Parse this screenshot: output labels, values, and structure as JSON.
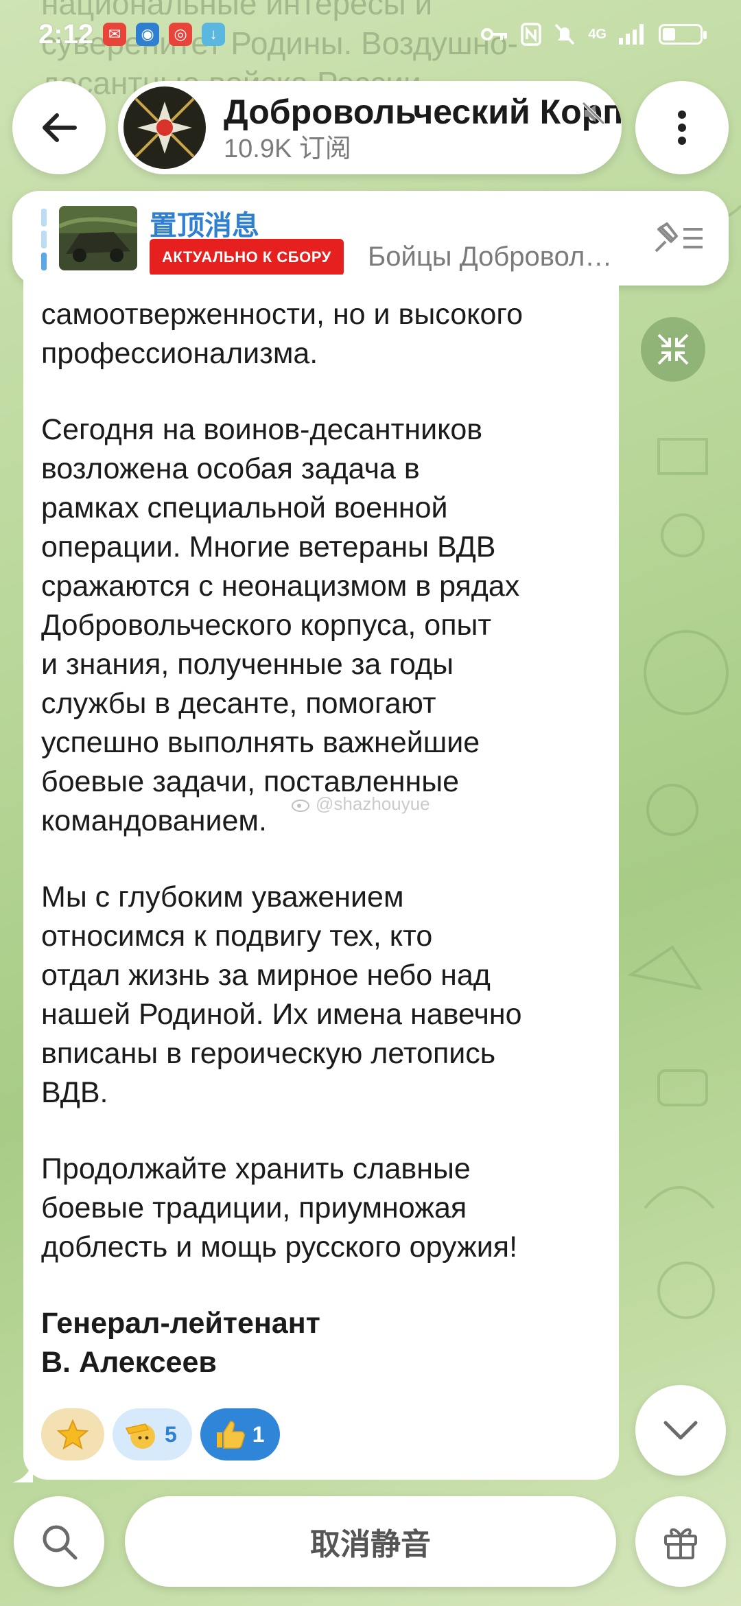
{
  "status_bar": {
    "time": "2:12",
    "network": "4G"
  },
  "background_text": "национальные интересы и суверенитет Родины. Воздушно-десантные войска России",
  "header": {
    "channel_title": "Добровольческий Корпус",
    "subscribers": "10.9K 订阅"
  },
  "pinned": {
    "label": "置顶消息",
    "tag": "АКТУАЛЬНО К СБОРУ",
    "preview": "Бойцы Добровол…"
  },
  "message": {
    "paragraphs": [
      "самоотверженности, но и высокого\nпрофессионализма.",
      "Сегодня на воинов-десантников\nвозложена особая задача в\nрамках специальной военной\nоперации. Многие ветераны ВДВ\nсражаются с неонацизмом в рядах\nДобровольческого корпуса, опыт\nи знания, полученные за годы\nслужбы в десанте, помогают\nуспешно выполнять важнейшие\nбоевые задачи, поставленные\nкомандованием.",
      "Мы с глубоким уважением\nотносимся к подвигу тех, кто\nотдал жизнь за мирное небо над\nнашей Родиной. Их имена навечно\nвписаны в героическую летопись\nВДВ.",
      "Продолжайте хранить славные\nбоевые традиции, приумножая\nдоблесть и мощь русского оружия!"
    ],
    "signature": "Генерал-лейтенант\nВ. Алексеев",
    "watermark": "@shazhouyue"
  },
  "reactions": [
    {
      "icon": "star",
      "count": ""
    },
    {
      "icon": "salute",
      "count": "5"
    },
    {
      "icon": "thumbs-up",
      "count": "1"
    }
  ],
  "bottom": {
    "unmute_label": "取消静音"
  }
}
